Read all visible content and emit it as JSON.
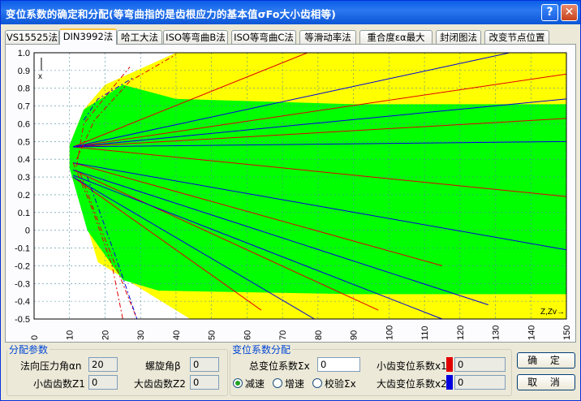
{
  "window": {
    "title": "变位系数的确定和分配(等弯曲指的是齿根应力的基本值σFo大小齿相等)",
    "help_label": "?",
    "close_label": "✕"
  },
  "tabs": [
    {
      "label": "VS15525法"
    },
    {
      "label": "DIN3992法",
      "active": true
    },
    {
      "label": "哈工大法"
    },
    {
      "label": "ISO等弯曲B法"
    },
    {
      "label": "ISO等弯曲C法"
    },
    {
      "label": "等滑动率法"
    },
    {
      "label": "重合度εα最大"
    },
    {
      "label": "封闭图法"
    },
    {
      "label": "改变节点位置"
    }
  ],
  "chart_data": {
    "type": "line",
    "xlim": [
      0,
      150
    ],
    "ylim": [
      -0.5,
      1.0
    ],
    "xticks": [
      "0",
      "10",
      "20",
      "30",
      "40",
      "50",
      "60",
      "70",
      "80",
      "90",
      "100",
      "110",
      "120",
      "130",
      "140",
      "150"
    ],
    "yticks": [
      "1.0",
      "0.9",
      "0.8",
      "0.7",
      "0.6",
      "0.5",
      "0.4",
      "0.3",
      "0.2",
      "0.1",
      "0",
      "-0.1",
      "-0.2",
      "-0.3",
      "-0.4",
      "-0.5"
    ],
    "xlabel": "Z,Zv→",
    "ylabel": "x",
    "grid": true,
    "colors": {
      "yellow": "#ffff00",
      "green": "#00ff00",
      "red": "#e00000",
      "blue": "#0000e0",
      "grid": "#4a8a9a"
    },
    "yellow_region": [
      [
        10,
        0.48
      ],
      [
        14,
        0.68
      ],
      [
        20,
        0.82
      ],
      [
        40,
        1.0
      ],
      [
        150,
        1.0
      ],
      [
        150,
        -0.5
      ],
      [
        44,
        -0.5
      ],
      [
        18,
        -0.18
      ],
      [
        10,
        0.35
      ]
    ],
    "green_region": [
      [
        10,
        0.48
      ],
      [
        14,
        0.68
      ],
      [
        25,
        0.82
      ],
      [
        40,
        0.74
      ],
      [
        90,
        0.71
      ],
      [
        150,
        0.71
      ],
      [
        150,
        -0.36
      ],
      [
        90,
        -0.36
      ],
      [
        35,
        -0.34
      ],
      [
        25,
        -0.28
      ],
      [
        15,
        0.0
      ],
      [
        10,
        0.35
      ]
    ],
    "fan_origin": [
      11,
      0.44
    ],
    "red_lines": [
      {
        "from": [
          11,
          0.47
        ],
        "to": [
          77,
          1.0
        ]
      },
      {
        "from": [
          11,
          0.47
        ],
        "to": [
          150,
          0.88
        ]
      },
      {
        "from": [
          11,
          0.47
        ],
        "to": [
          150,
          0.63
        ]
      },
      {
        "from": [
          11,
          0.47
        ],
        "to": [
          150,
          0.19
        ]
      },
      {
        "from": [
          11,
          0.38
        ],
        "to": [
          115,
          -0.2
        ]
      },
      {
        "from": [
          11,
          0.34
        ],
        "to": [
          97,
          -0.45
        ]
      },
      {
        "from": [
          11,
          0.3
        ],
        "to": [
          64,
          -0.45
        ]
      }
    ],
    "blue_lines": [
      {
        "from": [
          11,
          0.47
        ],
        "to": [
          134,
          1.0
        ]
      },
      {
        "from": [
          11,
          0.47
        ],
        "to": [
          150,
          0.74
        ]
      },
      {
        "from": [
          11,
          0.47
        ],
        "to": [
          150,
          0.5
        ]
      },
      {
        "from": [
          11,
          0.38
        ],
        "to": [
          150,
          -0.11
        ]
      },
      {
        "from": [
          11,
          0.34
        ],
        "to": [
          128,
          -0.42
        ]
      },
      {
        "from": [
          11,
          0.31
        ],
        "to": [
          115,
          -0.5
        ]
      },
      {
        "from": [
          11,
          0.3
        ],
        "to": [
          79,
          -0.5
        ]
      }
    ],
    "dashed_lines": [
      {
        "points": [
          [
            12,
            0.36
          ],
          [
            14,
            0.6
          ],
          [
            22,
            0.8
          ],
          [
            27,
            0.92
          ]
        ],
        "color": "#e00000"
      },
      {
        "points": [
          [
            12,
            0.4
          ],
          [
            17,
            0.62
          ],
          [
            27,
            0.84
          ],
          [
            40,
            0.99
          ]
        ],
        "color": "#e00000"
      },
      {
        "points": [
          [
            11,
            0.38
          ],
          [
            16,
            0.14
          ],
          [
            22,
            -0.2
          ],
          [
            25,
            -0.5
          ]
        ],
        "color": "#e00000"
      },
      {
        "points": [
          [
            13,
            0.32
          ],
          [
            19,
            0.0
          ],
          [
            25,
            -0.3
          ],
          [
            29,
            -0.5
          ]
        ],
        "color": "#e00000"
      },
      {
        "points": [
          [
            14,
            0.62
          ],
          [
            18,
            0.74
          ],
          [
            28,
            0.86
          ]
        ],
        "color": "#0000e0"
      },
      {
        "points": [
          [
            15,
            0.3
          ],
          [
            23,
            -0.15
          ],
          [
            29,
            -0.5
          ]
        ],
        "color": "#0000e0"
      }
    ]
  },
  "left_group": {
    "legend": "分配参数",
    "pressure_angle_label": "法向压力角αn",
    "pressure_angle_value": "20",
    "helix_angle_label": "螺旋角β",
    "helix_angle_value": "0",
    "small_teeth_label": "小齿齿数Z1",
    "small_teeth_value": "0",
    "large_teeth_label": "大齿齿数Z2",
    "large_teeth_value": "0"
  },
  "right_group": {
    "legend": "变位系数分配",
    "total_label": "总变位系数Σx",
    "total_value": "0",
    "small_coef_label": "小齿变位系数x1",
    "small_coef_value": "0",
    "small_color": "#e00000",
    "large_coef_label": "大齿变位系数x2",
    "large_coef_value": "0",
    "large_color": "#0000e0",
    "radios": [
      {
        "label": "减速",
        "checked": true
      },
      {
        "label": "增速",
        "checked": false
      },
      {
        "label": "校验Σx",
        "checked": false
      }
    ]
  },
  "buttons": {
    "ok": "确 定",
    "cancel": "取 消"
  }
}
